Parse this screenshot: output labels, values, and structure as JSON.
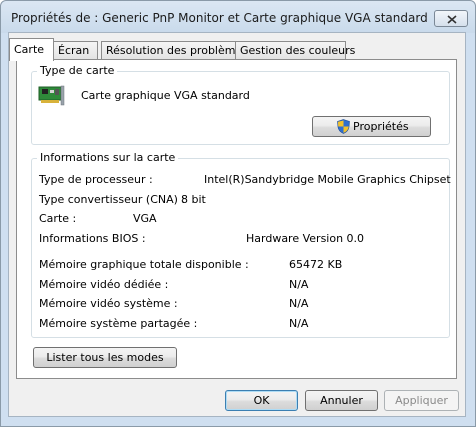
{
  "window": {
    "title": "Propriétés de : Generic PnP Monitor et Carte graphique VGA standard"
  },
  "tabs": [
    {
      "label": "Carte",
      "active": true
    },
    {
      "label": "Écran",
      "active": false
    },
    {
      "label": "Résolution des problèmes",
      "active": false
    },
    {
      "label": "Gestion des couleurs",
      "active": false
    }
  ],
  "adapter_type": {
    "group_label": "Type de carte",
    "adapter_name": "Carte graphique VGA standard",
    "properties_button": "Propriétés"
  },
  "adapter_info": {
    "group_label": "Informations sur la carte",
    "rows": [
      {
        "label": "Type de processeur :",
        "value": "Intel(R)Sandybridge Mobile Graphics Chipset"
      },
      {
        "label": "Type convertisseur (CNA) :",
        "value": "8 bit"
      },
      {
        "label": "Carte :",
        "value": "VGA"
      },
      {
        "label": "Informations BIOS :",
        "value": "Hardware Version 0.0"
      }
    ],
    "memory_rows": [
      {
        "label": "Mémoire graphique totale disponible :",
        "value": "65472 KB"
      },
      {
        "label": "Mémoire vidéo dédiée :",
        "value": "N/A"
      },
      {
        "label": "Mémoire vidéo système :",
        "value": "N/A"
      },
      {
        "label": "Mémoire système partagée :",
        "value": "N/A"
      }
    ]
  },
  "list_modes_button": "Lister tous les modes",
  "footer": {
    "ok": "OK",
    "cancel": "Annuler",
    "apply": "Appliquer"
  },
  "colors": {
    "titlebar": "#cfdff0",
    "shield_blue": "#2f6fd0",
    "shield_yellow": "#f3c12b",
    "board_green": "#2f8a3a"
  }
}
